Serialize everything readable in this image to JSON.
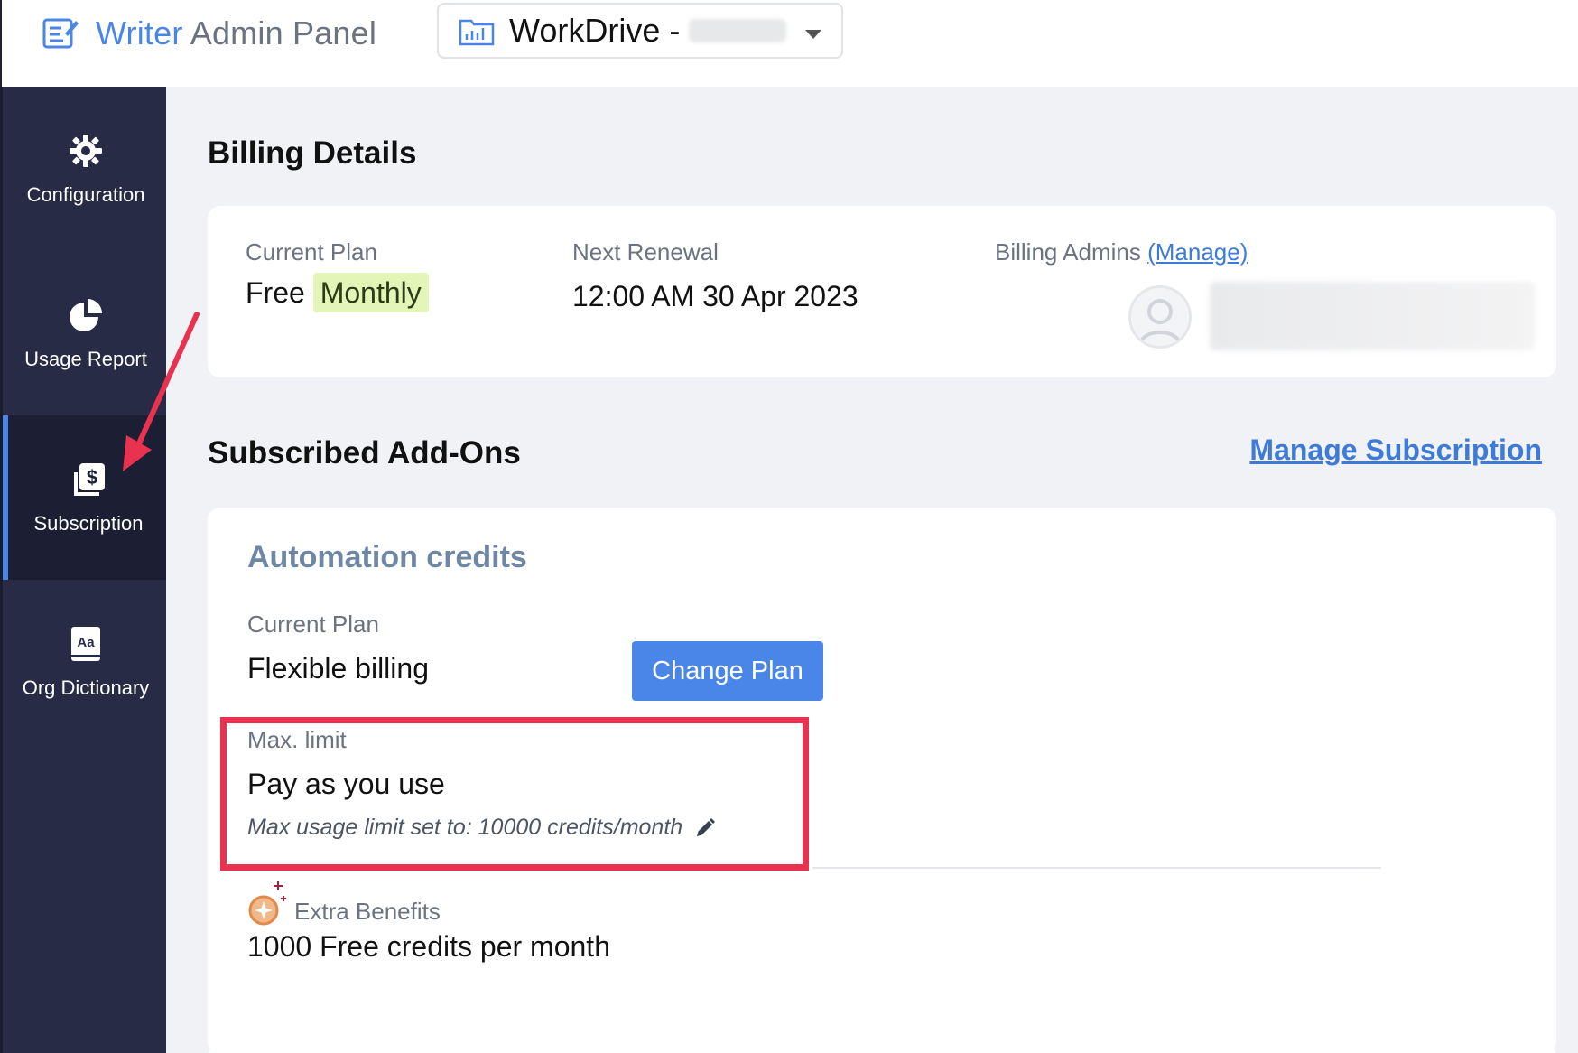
{
  "header": {
    "title_part1": "Writer",
    "title_part2": "Admin Panel",
    "workspace_name": "WorkDrive -"
  },
  "sidebar": {
    "items": [
      {
        "label": "Configuration",
        "icon": "gear-icon"
      },
      {
        "label": "Usage Report",
        "icon": "pie-chart-icon"
      },
      {
        "label": "Subscription",
        "icon": "dollar-icon",
        "active": true
      },
      {
        "label": "Org Dictionary",
        "icon": "dictionary-icon"
      }
    ]
  },
  "billing": {
    "heading": "Billing Details",
    "current_plan_label": "Current Plan",
    "plan_name": "Free",
    "plan_badge": "Monthly",
    "next_renewal_label": "Next Renewal",
    "next_renewal_value": "12:00 AM 30 Apr 2023",
    "billing_admins_label": "Billing Admins",
    "manage_link": "(Manage)"
  },
  "addons": {
    "heading": "Subscribed Add-Ons",
    "manage_subscription": "Manage Subscription",
    "automation": {
      "title": "Automation credits",
      "current_plan_label": "Current Plan",
      "current_plan_value": "Flexible billing",
      "change_plan_button": "Change Plan",
      "max_limit_label": "Max. limit",
      "max_limit_value": "Pay as you use",
      "max_limit_note": "Max usage limit set to: 10000 credits/month",
      "extra_benefits_label": "Extra Benefits",
      "extra_benefits_value": "1000 Free credits per month"
    }
  },
  "colors": {
    "accent": "#4a86e8",
    "sidebar_bg": "#272b45",
    "highlight": "#e8324f",
    "badge_bg": "#e4f5b8"
  }
}
